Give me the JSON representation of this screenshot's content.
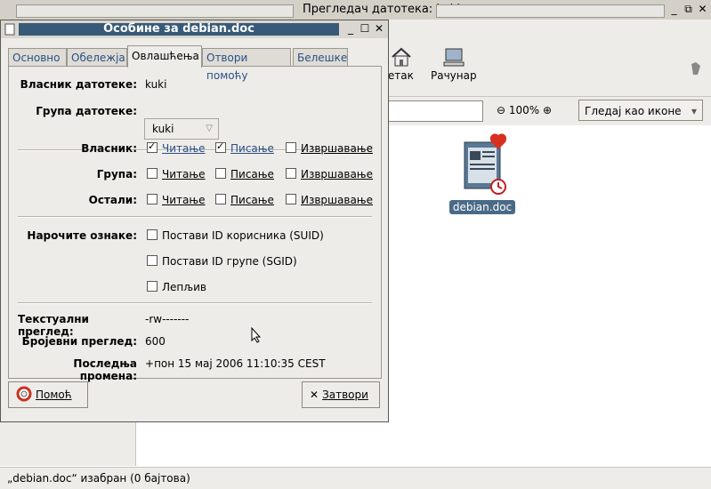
{
  "fm": {
    "title": "Прегледач датотека: kuki",
    "toolbar": {
      "home_label": "нетак",
      "computer_label": "Рачунар"
    },
    "zoom_level": "100%",
    "view_label": "Гледај као иконе",
    "file_name": "debian.doc",
    "status": "„debian.doc“ изабран (0 бајтова)"
  },
  "dialog": {
    "title": "Особине за debian.doc",
    "tabs": [
      "Основно",
      "Обележја",
      "Овлашћења",
      "Отвори помоћу",
      "Белешке"
    ],
    "owner_label": "Власник датотеке:",
    "owner_value": "kuki",
    "group_label": "Група датотеке:",
    "group_value": "kuki",
    "perm_rows": [
      {
        "label": "Власник:",
        "read": true,
        "write": true,
        "exec": false
      },
      {
        "label": "Група:",
        "read": false,
        "write": false,
        "exec": false
      },
      {
        "label": "Остали:",
        "read": false,
        "write": false,
        "exec": false
      }
    ],
    "perm_names": {
      "read": "Читање",
      "write": "Писање",
      "exec": "Извршавање"
    },
    "special_label": "Нарочите ознаке:",
    "special": [
      {
        "label": "Постави ID корисника (SUID)",
        "checked": false
      },
      {
        "label": "Постави ID групе (SGID)",
        "checked": false
      },
      {
        "label": "Лепљив",
        "checked": false
      }
    ],
    "text_view_label": "Текстуални преглед:",
    "text_view_value": "-rw-------",
    "num_view_label": "Бројевни преглед:",
    "num_view_value": "600",
    "last_change_label": "Последња промена:",
    "last_change_value": "пон 15 мај 2006 11:10:35 CEST",
    "help_button": "Помоћ",
    "close_button": "Затвори"
  },
  "colors": {
    "title_bar": "#375a78",
    "link_blue": "#2a4f86",
    "selection": "#4a6a88"
  }
}
